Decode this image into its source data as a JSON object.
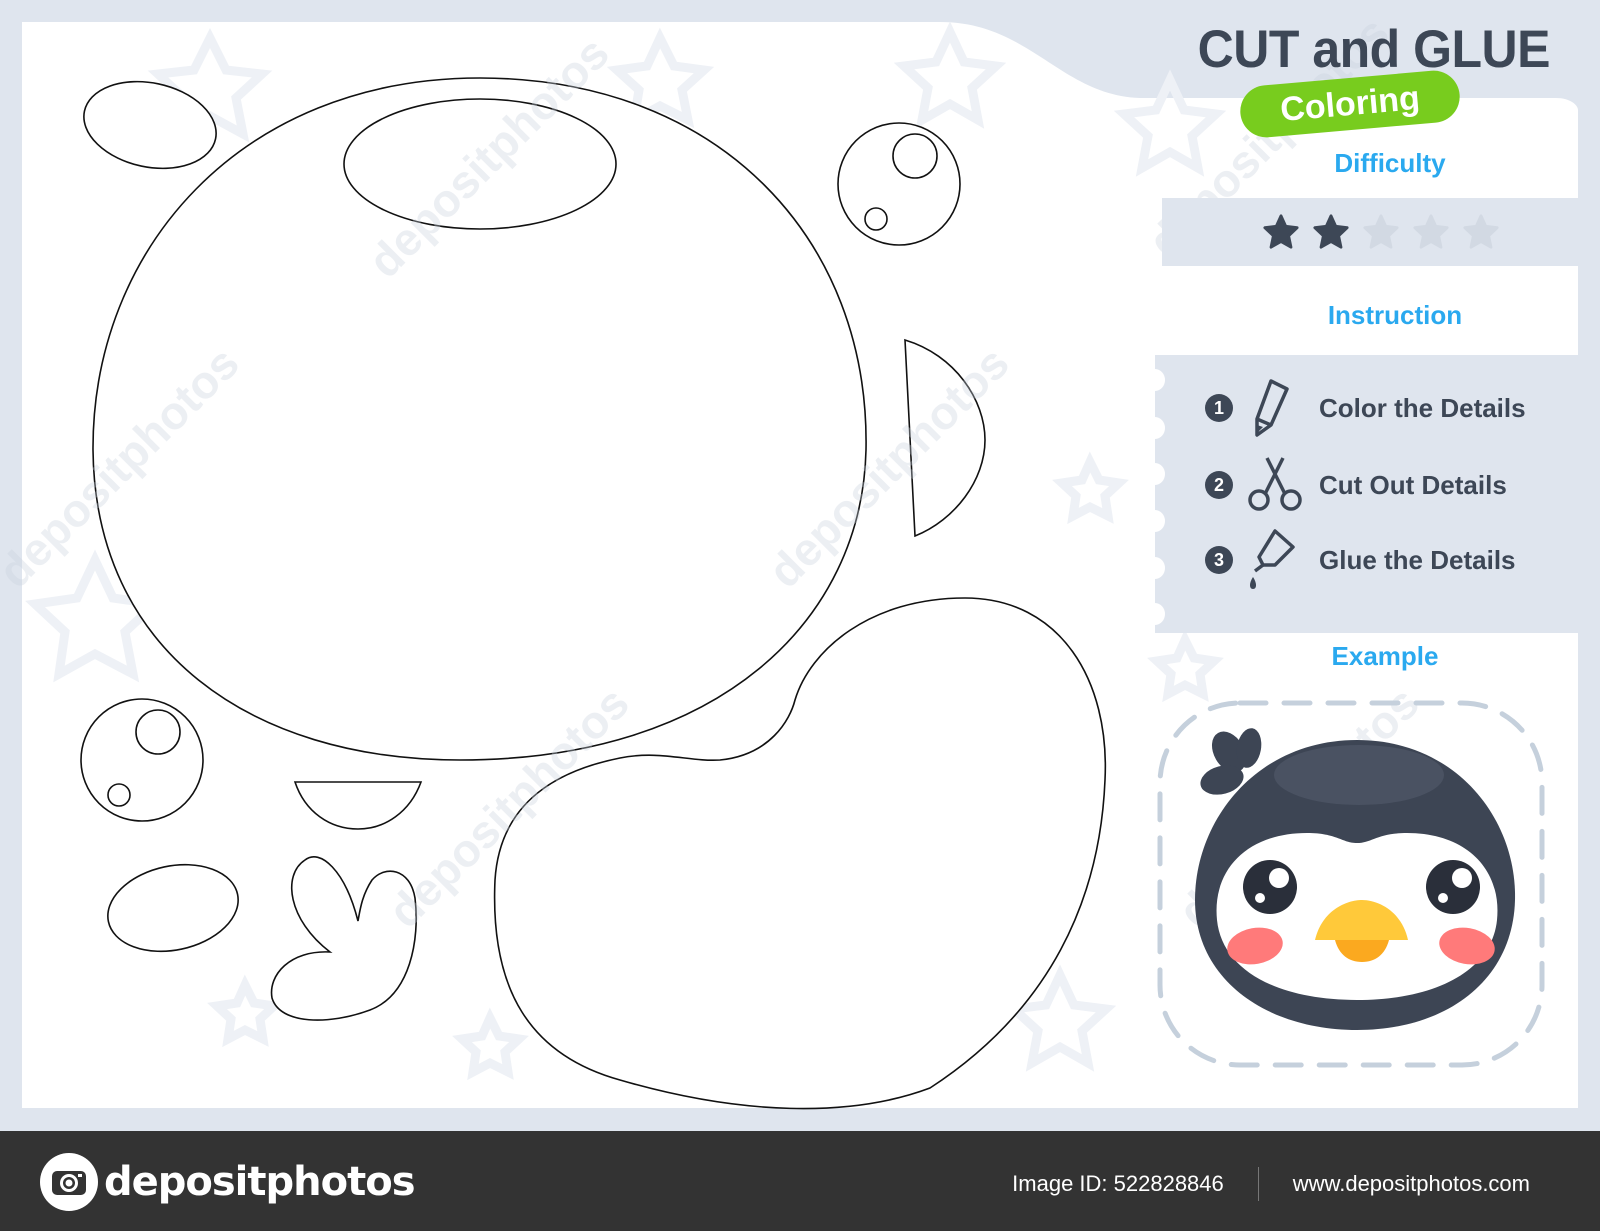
{
  "header": {
    "title": "CUT and GLUE",
    "badge": "Coloring"
  },
  "difficulty": {
    "label": "Difficulty",
    "rating": 2,
    "max_rating": 5
  },
  "instruction": {
    "label": "Instruction",
    "steps": [
      {
        "number": "1",
        "icon": "pencil-icon",
        "label": "Color the Details"
      },
      {
        "number": "2",
        "icon": "scissors-icon",
        "label": "Cut Out Details"
      },
      {
        "number": "3",
        "icon": "glue-icon",
        "label": "Glue the Details"
      }
    ]
  },
  "example": {
    "label": "Example",
    "subject": "penguin face"
  },
  "pieces": [
    "head-outline",
    "head-highlight",
    "crest-leaf",
    "eye-right",
    "eye-left",
    "beak-top-right",
    "beak-bottom",
    "cheek-left",
    "crest-tuft",
    "face-white"
  ],
  "colors": {
    "title": "#3d4756",
    "badge": "#78cc1e",
    "section_label": "#2aa9ef",
    "panel": "#dfe5ee",
    "penguin_dark": "#3d4554",
    "beak": "#ffc93a",
    "beak_lower": "#fba91f",
    "cheek": "#ff7a7a"
  },
  "watermark": {
    "text": "depositphotos"
  },
  "footer": {
    "brand": "depositphotos",
    "image_id": "Image ID: 522828846",
    "url": "www.depositphotos.com"
  }
}
